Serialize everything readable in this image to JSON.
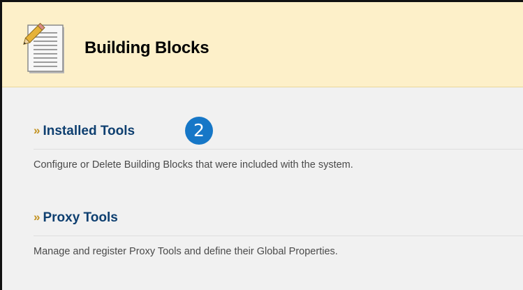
{
  "header": {
    "title": "Building Blocks",
    "icon": "document-pencil-icon"
  },
  "sections": [
    {
      "link_label": "Installed Tools",
      "description": "Configure or Delete Building Blocks that were included with the system.",
      "step_badge": "2"
    },
    {
      "link_label": "Proxy Tools",
      "description": "Manage and register Proxy Tools and define their Global Properties."
    }
  ],
  "colors": {
    "header_bg": "#fdf0c9",
    "page_bg": "#f1f1f1",
    "link": "#0e3f70",
    "chevron": "#c2911f",
    "badge": "#1677c7"
  }
}
